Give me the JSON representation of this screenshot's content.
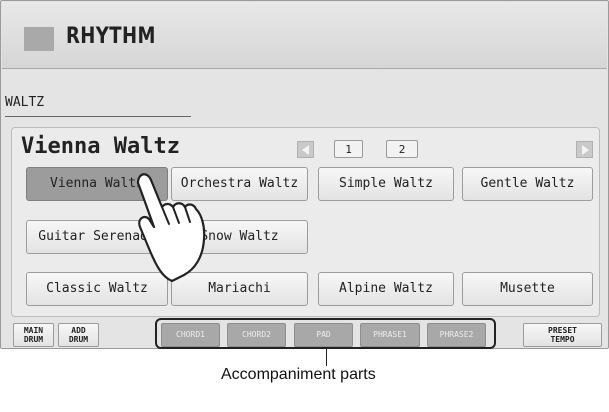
{
  "header": {
    "title": "RHYTHM"
  },
  "category": "WALTZ",
  "bank": {
    "name": "Vienna Waltz",
    "pages": [
      "1",
      "2"
    ],
    "current_page": "1"
  },
  "voices": [
    {
      "label": "Vienna Waltz",
      "selected": true
    },
    {
      "label": "Orchestra Waltz"
    },
    {
      "label": "Simple Waltz"
    },
    {
      "label": "Gentle Waltz"
    },
    {
      "label": "Guitar Serenade"
    },
    {
      "label": "Snow Waltz"
    },
    {
      "label": "Classic Waltz"
    },
    {
      "label": "Mariachi"
    },
    {
      "label": "Alpine Waltz"
    },
    {
      "label": "Musette"
    }
  ],
  "toolbar": {
    "main_drum": [
      "MAIN",
      "DRUM"
    ],
    "add_drum": [
      "ADD",
      "DRUM"
    ],
    "parts": [
      "CHORD1",
      "CHORD2",
      "PAD",
      "PHRASE1",
      "PHRASE2"
    ],
    "preset_tempo": [
      "PRESET",
      "TEMPO"
    ]
  },
  "annotation": "Accompaniment parts",
  "colors": {
    "selected": "#9c9c9c",
    "disabled_part": "#a8a8a8",
    "screen_bg": "#e4e4e4"
  }
}
